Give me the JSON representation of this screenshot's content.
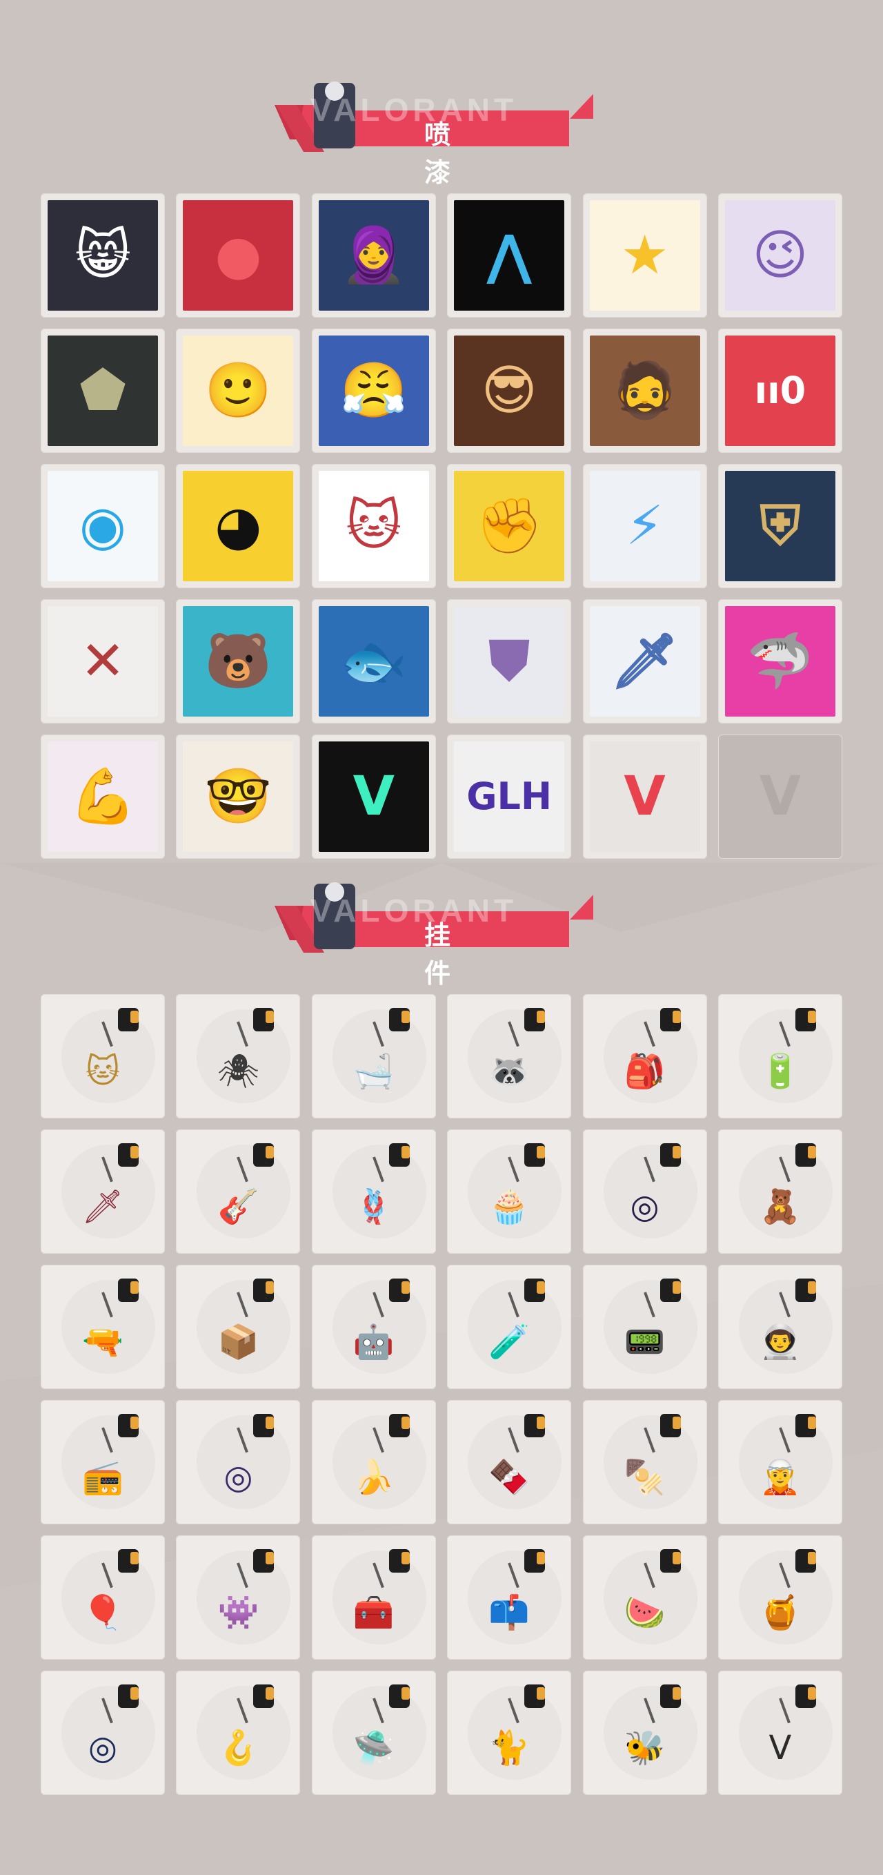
{
  "sections": {
    "sprays": {
      "title": "喷 漆"
    },
    "charms": {
      "title": "挂 件"
    }
  },
  "colors": {
    "background": "#cbc3c0",
    "banner_red": "#e8425a",
    "tile": "#efebe8"
  },
  "sprays": [
    {
      "icon": "grumpy-cat-spray-icon",
      "glyph": "😸",
      "bg": "#2e2e3a",
      "fg": "#ffffff"
    },
    {
      "icon": "red-blob-spray-icon",
      "glyph": "●",
      "bg": "#c8303f",
      "fg": "#f25a63"
    },
    {
      "icon": "hooded-girl-spray-icon",
      "glyph": "🧕",
      "bg": "#2a3f6a",
      "fg": "#ffffff"
    },
    {
      "icon": "blue-claw-spray-icon",
      "glyph": "⋀",
      "bg": "#0c0c0c",
      "fg": "#3fb6ea"
    },
    {
      "icon": "gold-star-spray-icon",
      "glyph": "★",
      "bg": "#fdf4e0",
      "fg": "#f7c12a"
    },
    {
      "icon": "winking-girl-spray-icon",
      "glyph": "😉",
      "bg": "#e6def0",
      "fg": "#7c5fb5"
    },
    {
      "icon": "dark-helmet-spray-icon",
      "glyph": "⬟",
      "bg": "#2f3331",
      "fg": "#b7b48a"
    },
    {
      "icon": "blonde-agent-spray-icon",
      "glyph": "🙂",
      "bg": "#fbeec8",
      "fg": "#cf8a3d"
    },
    {
      "icon": "blue-beanie-girl-spray-icon",
      "glyph": "😤",
      "bg": "#3b5fb3",
      "fg": "#ffffff"
    },
    {
      "icon": "sunglasses-agent-spray-icon",
      "glyph": "😎",
      "bg": "#5a3420",
      "fg": "#f0c080"
    },
    {
      "icon": "bearded-agent-spray-icon",
      "glyph": "🧔",
      "bg": "#8a5a3c",
      "fg": "#f4d3a8"
    },
    {
      "icon": "ammo-counter-spray-icon",
      "glyph": "ıı0",
      "bg": "#e3414d",
      "fg": "#ffffff"
    },
    {
      "icon": "blue-orb-spray-icon",
      "glyph": "◉",
      "bg": "#f4f8fb",
      "fg": "#2aa8e6"
    },
    {
      "icon": "yellow-critter-spray-icon",
      "glyph": "◕",
      "bg": "#f7cf2e",
      "fg": "#111111"
    },
    {
      "icon": "headband-cat-spray-icon",
      "glyph": "🐱",
      "bg": "#ffffff",
      "fg": "#c1383e"
    },
    {
      "icon": "gauntlet-grenade-spray-icon",
      "glyph": "✊",
      "bg": "#f3d23c",
      "fg": "#444444"
    },
    {
      "icon": "neon-butterfly-spray-icon",
      "glyph": "⚡",
      "bg": "#eef1f6",
      "fg": "#4aa8f0"
    },
    {
      "icon": "anubis-mask-spray-icon",
      "glyph": "⛨",
      "bg": "#263a55",
      "fg": "#d7b36a"
    },
    {
      "icon": "red-x-button-spray-icon",
      "glyph": "✕",
      "bg": "#f1eeee",
      "fg": "#b23b3b"
    },
    {
      "icon": "surfing-bear-spray-icon",
      "glyph": "🐻",
      "bg": "#3ab4c8",
      "fg": "#6b4a2c"
    },
    {
      "icon": "koi-fish-spray-icon",
      "glyph": "🐟",
      "bg": "#2d6fb6",
      "fg": "#e2502c"
    },
    {
      "icon": "armored-agent-spray-icon",
      "glyph": "⛊",
      "bg": "#e9eaf0",
      "fg": "#8a6ab0"
    },
    {
      "icon": "white-hair-agent-spray-icon",
      "glyph": "🗡",
      "bg": "#eef1f6",
      "fg": "#4a6fb5"
    },
    {
      "icon": "neon-shark-spray-icon",
      "glyph": "🦈",
      "bg": "#e83fa7",
      "fg": "#2a5fb3"
    },
    {
      "icon": "gamer-girl-spray-icon",
      "glyph": "💪",
      "bg": "#f3e9f0",
      "fg": "#e7a52a"
    },
    {
      "icon": "glasses-agent-spray-icon",
      "glyph": "🤓",
      "bg": "#f3ece2",
      "fg": "#3a3a3a"
    },
    {
      "icon": "valorant-logo-teal-spray-icon",
      "glyph": "V",
      "bg": "#111111",
      "fg": "#3ef0c0"
    },
    {
      "icon": "graffiti-tag-spray-icon",
      "glyph": "GLH",
      "bg": "#f0f0f0",
      "fg": "#4b2fa6"
    },
    {
      "icon": "valorant-logo-red-spray-icon",
      "glyph": "V",
      "bg": "#e8e4e1",
      "fg": "#e8424f"
    },
    {
      "icon": "empty-slot-spray-icon",
      "glyph": "V",
      "bg": "#c1b9b6",
      "fg": "#b2aaa6"
    }
  ],
  "charms": [
    {
      "icon": "gold-cat-charm-icon",
      "glyph": "🐱",
      "color": "#b88a2e"
    },
    {
      "icon": "spider-drone-charm-icon",
      "glyph": "🕷",
      "color": "#3a3a3a"
    },
    {
      "icon": "bathtub-charm-icon",
      "glyph": "🛁",
      "color": "#7a7a7a"
    },
    {
      "icon": "raccoon-charm-icon",
      "glyph": "🦝",
      "color": "#5f6f7a"
    },
    {
      "icon": "backpack-charm-icon",
      "glyph": "🎒",
      "color": "#4a4a3a"
    },
    {
      "icon": "energy-cell-charm-icon",
      "glyph": "🔋",
      "color": "#d66a2c"
    },
    {
      "icon": "spiked-blade-charm-icon",
      "glyph": "🗡",
      "color": "#8a2a3a"
    },
    {
      "icon": "guitar-charm-icon",
      "glyph": "🎸",
      "color": "#d8842c"
    },
    {
      "icon": "rope-charm-icon",
      "glyph": "🪢",
      "color": "#6a2a2a"
    },
    {
      "icon": "cupcake-charm-icon",
      "glyph": "🧁",
      "color": "#c46aa0"
    },
    {
      "icon": "ep9-badge-charm-icon",
      "glyph": "◎",
      "color": "#2a1f4a"
    },
    {
      "icon": "boxing-bear-charm-icon",
      "glyph": "🧸",
      "color": "#8a4a2a"
    },
    {
      "icon": "pistol-holster-charm-icon",
      "glyph": "🔫",
      "color": "#5a4030"
    },
    {
      "icon": "crate-charm-icon",
      "glyph": "📦",
      "color": "#8a5a3a"
    },
    {
      "icon": "robot-mascot-charm-icon",
      "glyph": "🤖",
      "color": "#2a2a4a"
    },
    {
      "icon": "lava-lamp-charm-icon",
      "glyph": "🧪",
      "color": "#b84aa0"
    },
    {
      "icon": "green-pager-charm-icon",
      "glyph": "📟",
      "color": "#5ab83a"
    },
    {
      "icon": "astronaut-charm-icon",
      "glyph": "👨‍🚀",
      "color": "#3a6ab8"
    },
    {
      "icon": "radio-device-charm-icon",
      "glyph": "📻",
      "color": "#d06a3a"
    },
    {
      "icon": "ep9-disc-charm-icon",
      "glyph": "◎",
      "color": "#3a2a6a"
    },
    {
      "icon": "banana-critter-charm-icon",
      "glyph": "🍌",
      "color": "#e0b83a"
    },
    {
      "icon": "popsicle-charm-icon",
      "glyph": "🍫",
      "color": "#8a4a3a"
    },
    {
      "icon": "skewer-charm-icon",
      "glyph": "🍢",
      "color": "#e04a2a"
    },
    {
      "icon": "agent-figure-charm-icon",
      "glyph": "🧝",
      "color": "#6a7a8a"
    },
    {
      "icon": "hot-air-balloon-charm-icon",
      "glyph": "🎈",
      "color": "#e06a2a"
    },
    {
      "icon": "pink-mascot-charm-icon",
      "glyph": "👾",
      "color": "#c08ae0"
    },
    {
      "icon": "ammo-box-charm-icon",
      "glyph": "🧰",
      "color": "#3a4a3a"
    },
    {
      "icon": "mailbox-robot-charm-icon",
      "glyph": "📫",
      "color": "#5a7a5a"
    },
    {
      "icon": "watermelon-charm-icon",
      "glyph": "🍉",
      "color": "#d84a4a"
    },
    {
      "icon": "beehive-charm-icon",
      "glyph": "🍯",
      "color": "#d09a3a"
    },
    {
      "icon": "ep9-gold-disc-charm-icon",
      "glyph": "◎",
      "color": "#1a2a5a"
    },
    {
      "icon": "hook-claw-charm-icon",
      "glyph": "🪝",
      "color": "#6a7a8a"
    },
    {
      "icon": "ufo-charm-icon",
      "glyph": "🛸",
      "color": "#4a6a8a"
    },
    {
      "icon": "gray-cat-charm-icon",
      "glyph": "🐈",
      "color": "#5a6070"
    },
    {
      "icon": "bee-charm-icon",
      "glyph": "🐝",
      "color": "#e0a02a"
    },
    {
      "icon": "valorant-tag-charm-icon",
      "glyph": "V",
      "color": "#2a2a2a"
    }
  ]
}
